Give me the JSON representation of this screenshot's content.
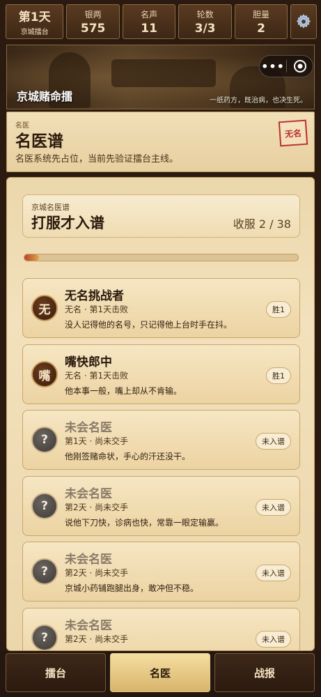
{
  "stats": {
    "day": "第1天",
    "day_sub": "京城擂台",
    "silver_label": "银两",
    "silver_value": "575",
    "fame_label": "名声",
    "fame_value": "11",
    "round_label": "轮数",
    "round_value": "3/3",
    "courage_label": "胆量",
    "courage_value": "2",
    "settings_icon": "gear-icon"
  },
  "banner": {
    "title": "京城赌命擂",
    "subtitle": "一纸药方，既治病，也决生死。",
    "capsule_more": "•••"
  },
  "header": {
    "small": "名医",
    "title": "名医谱",
    "desc": "名医系统先占位，当前先验证擂台主线。",
    "stamp": "无名"
  },
  "summary": {
    "small": "京城名医谱",
    "title": "打服才入谱",
    "count": "收服 2 / 38",
    "progress_fraction": 0.053
  },
  "entries": [
    {
      "avatar": "无",
      "name": "无名挑战者",
      "meta": "无名 · 第1天击败",
      "quote": "没人记得他的名号，只记得他上台时手在抖。",
      "badge": "胜1"
    },
    {
      "avatar": "嘴",
      "name": "嘴快郎中",
      "meta": "无名 · 第1天击败",
      "quote": "他本事一般，嘴上却从不肯输。",
      "badge": "胜1"
    },
    {
      "avatar": "?",
      "name": "未会名医",
      "meta": "第1天 · 尚未交手",
      "quote": "他刚签赌命状，手心的汗还没干。",
      "badge": "未入谱"
    },
    {
      "avatar": "?",
      "name": "未会名医",
      "meta": "第2天 · 尚未交手",
      "quote": "说他下刀快，诊病也快，常靠一眼定输赢。",
      "badge": "未入谱"
    },
    {
      "avatar": "?",
      "name": "未会名医",
      "meta": "第2天 · 尚未交手",
      "quote": "京城小药铺跑腿出身，敢冲但不稳。",
      "badge": "未入谱"
    },
    {
      "avatar": "?",
      "name": "未会名医",
      "meta": "第2天 · 尚未交手",
      "quote": "",
      "badge": "未入谱"
    }
  ],
  "nav": {
    "arena": "擂台",
    "doctors": "名医",
    "reports": "战报"
  },
  "colors": {
    "accent": "#b8322b",
    "panel": "#f2e1bc",
    "dark": "#2b1a10"
  }
}
